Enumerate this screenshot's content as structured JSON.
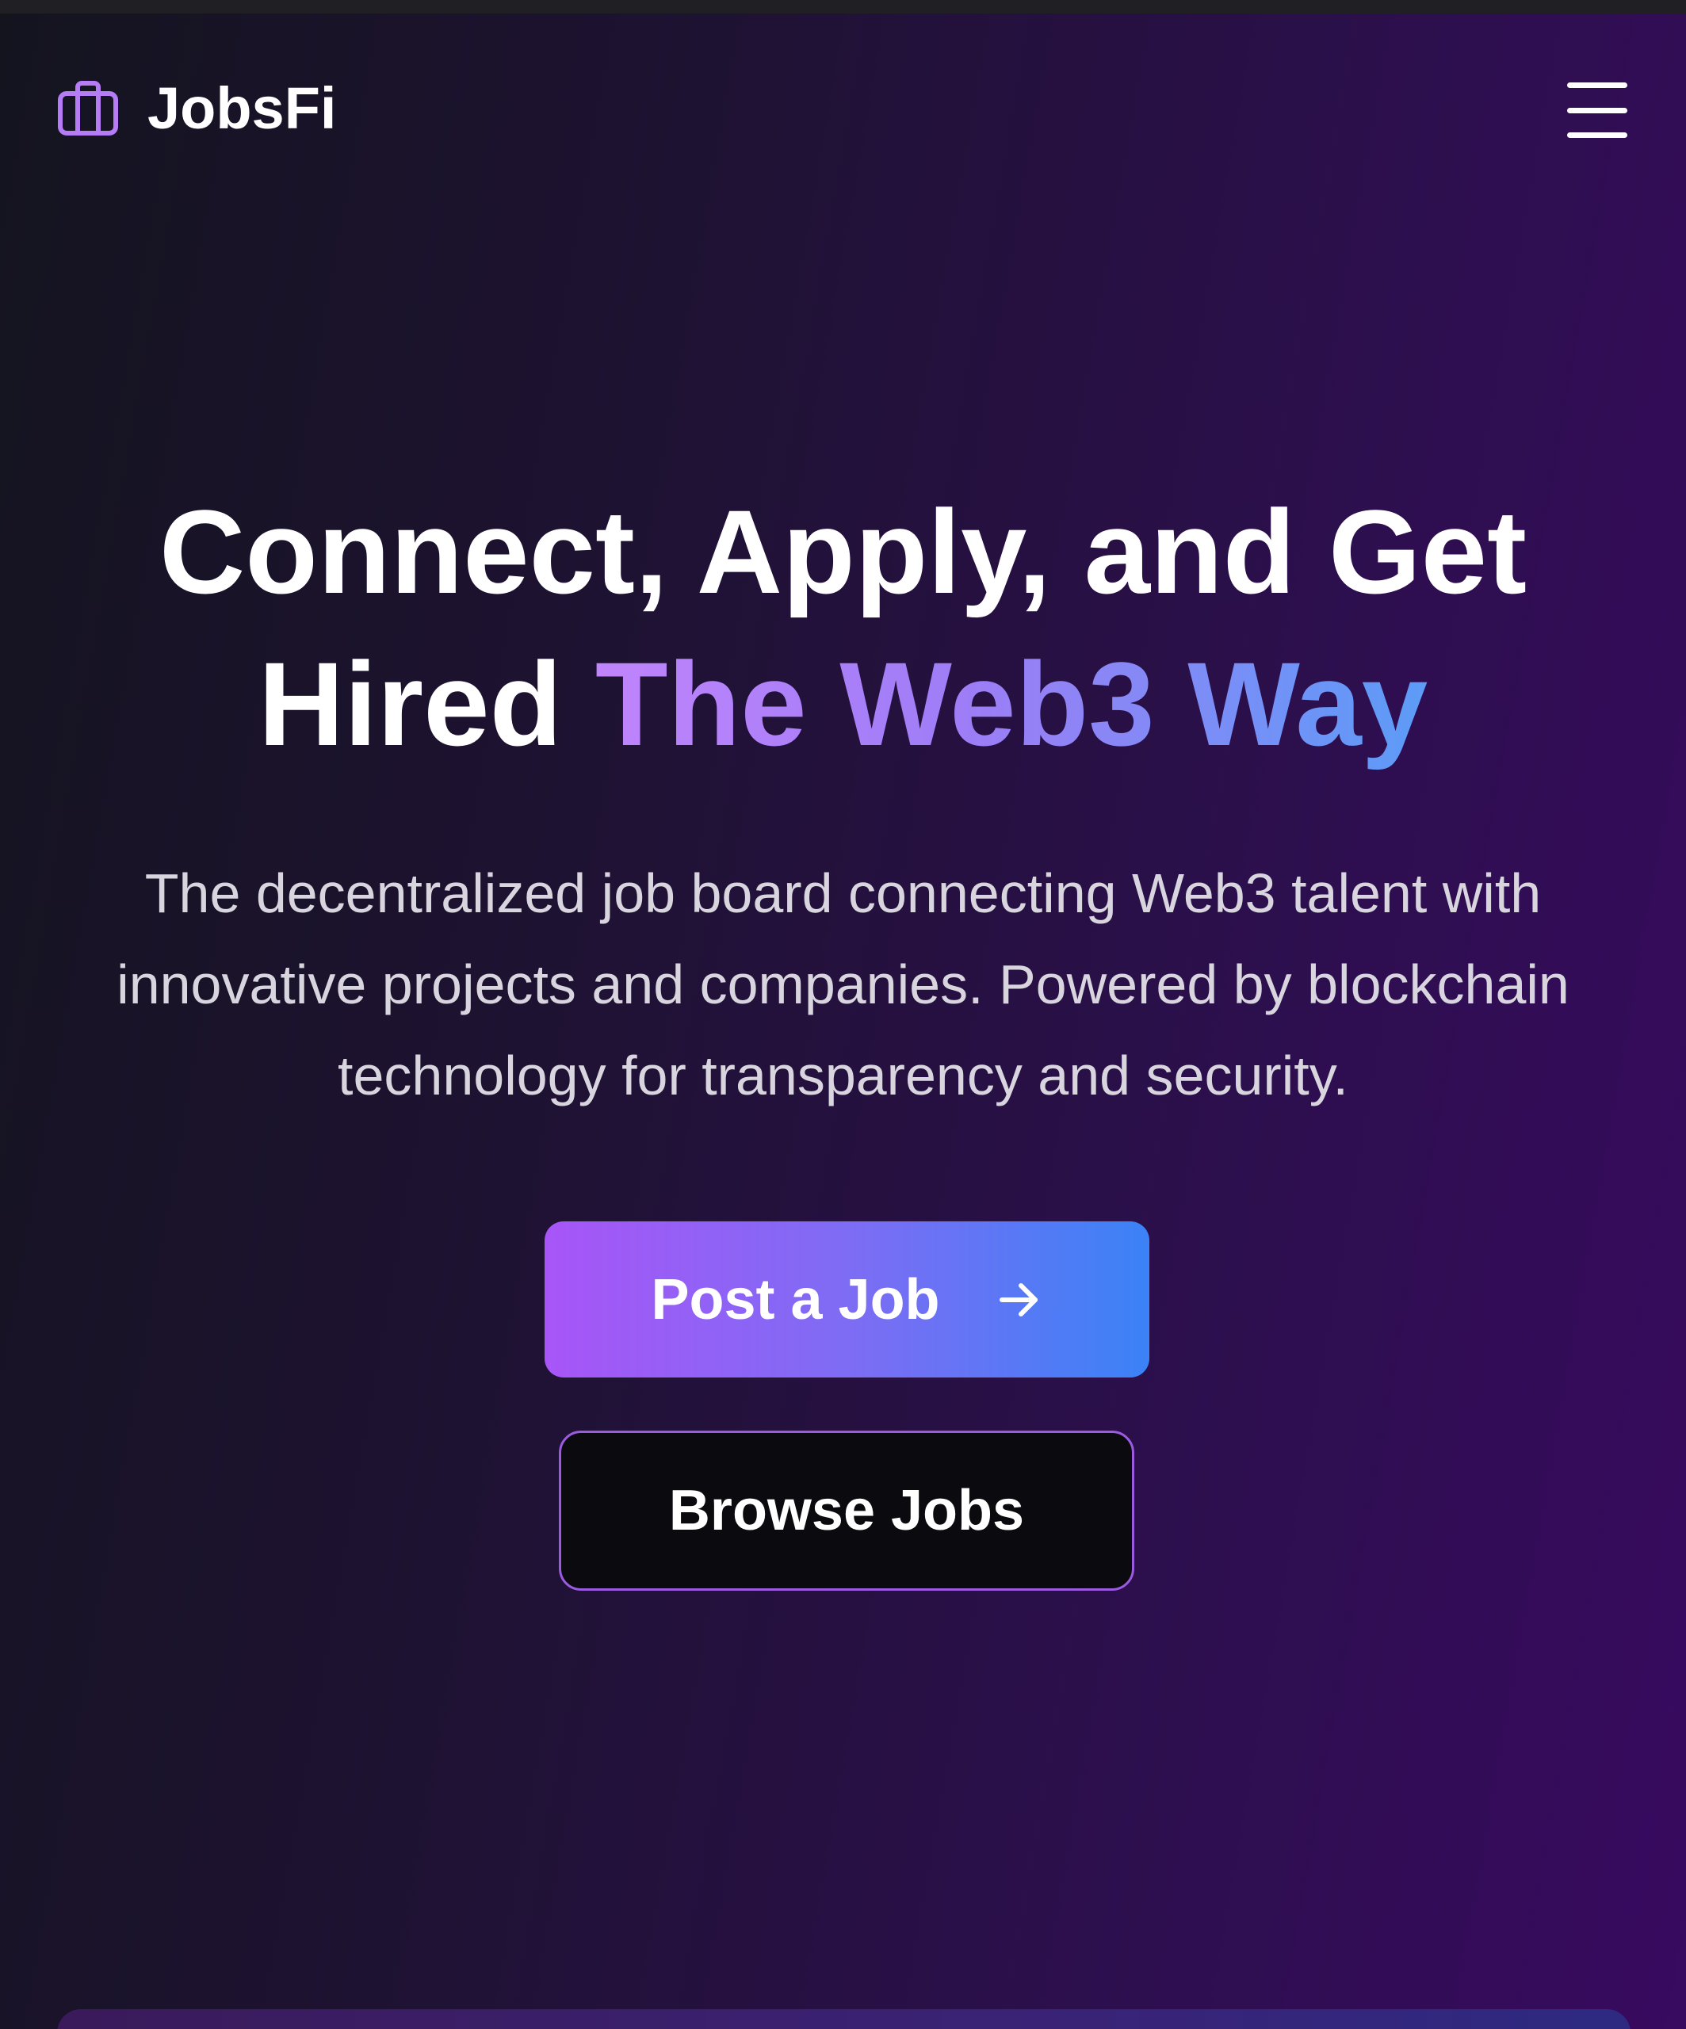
{
  "header": {
    "brand_name": "JobsFi",
    "brand_icon": "briefcase-icon",
    "menu_icon": "hamburger-menu-icon"
  },
  "hero": {
    "title_plain": "Connect, Apply, and Get Hired",
    "title_highlight": "The Web3 Way",
    "subtitle": "The decentralized job board connecting Web3 talent with innovative projects and companies. Powered by blockchain technology for transparency and security."
  },
  "actions": {
    "post_job_label": "Post a Job",
    "post_job_icon": "arrow-right-icon",
    "browse_jobs_label": "Browse Jobs"
  },
  "colors": {
    "accent_purple": "#a855f7",
    "accent_blue": "#3b82f6",
    "background_dark": "#14141f",
    "background_purple": "#380a60"
  }
}
